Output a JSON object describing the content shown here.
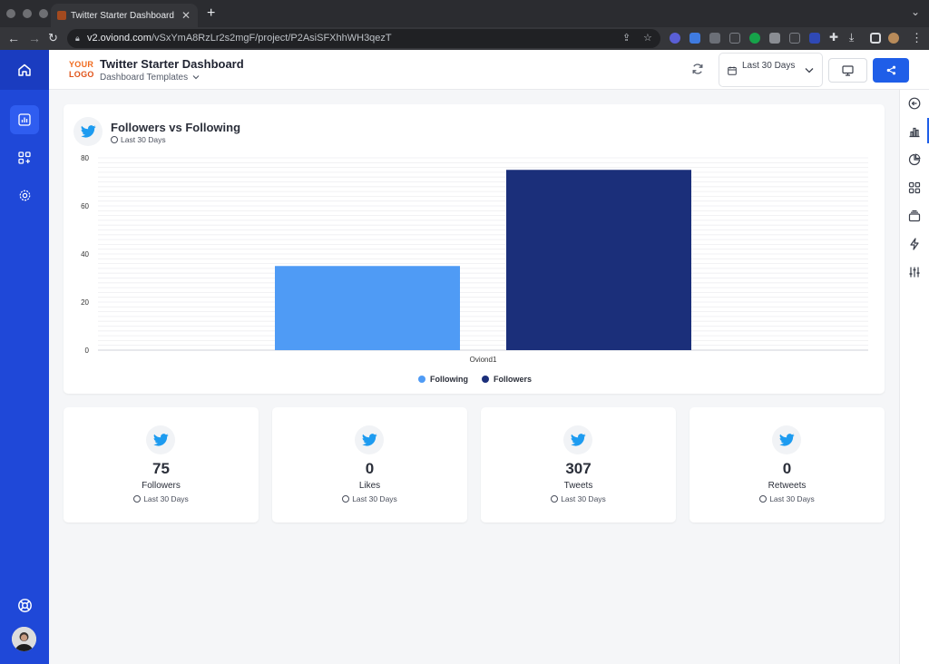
{
  "browser": {
    "tab_title": "Twitter Starter Dashboard",
    "url_domain": "v2.oviond.com",
    "url_path": "/vSxYmA8RzLr2s2mgF/project/P2AsiSFXhhWH3qezT"
  },
  "header": {
    "logo_line1": "YOUR",
    "logo_line2": "LOGO",
    "title": "Twitter Starter Dashboard",
    "subtitle": "Dashboard Templates",
    "date_range": "Last 30 Days"
  },
  "chart_card": {
    "title": "Followers vs Following",
    "period": "Last 30 Days"
  },
  "chart_data": {
    "type": "bar",
    "categories": [
      "Oviond1"
    ],
    "series": [
      {
        "name": "Following",
        "values": [
          35
        ],
        "color": "#4f9bf5"
      },
      {
        "name": "Followers",
        "values": [
          75
        ],
        "color": "#1b2f7a"
      }
    ],
    "ylim": [
      0,
      80
    ],
    "yticks": [
      0,
      20,
      40,
      60,
      80
    ],
    "grid": true,
    "legend": "bottom"
  },
  "stats": [
    {
      "value": "75",
      "label": "Followers",
      "period": "Last 30 Days"
    },
    {
      "value": "0",
      "label": "Likes",
      "period": "Last 30 Days"
    },
    {
      "value": "307",
      "label": "Tweets",
      "period": "Last 30 Days"
    },
    {
      "value": "0",
      "label": "Retweets",
      "period": "Last 30 Days"
    }
  ],
  "colors": {
    "sidebar": "#1f48d8",
    "accent": "#1f5ee8",
    "twitter": "#1d9bf0"
  }
}
